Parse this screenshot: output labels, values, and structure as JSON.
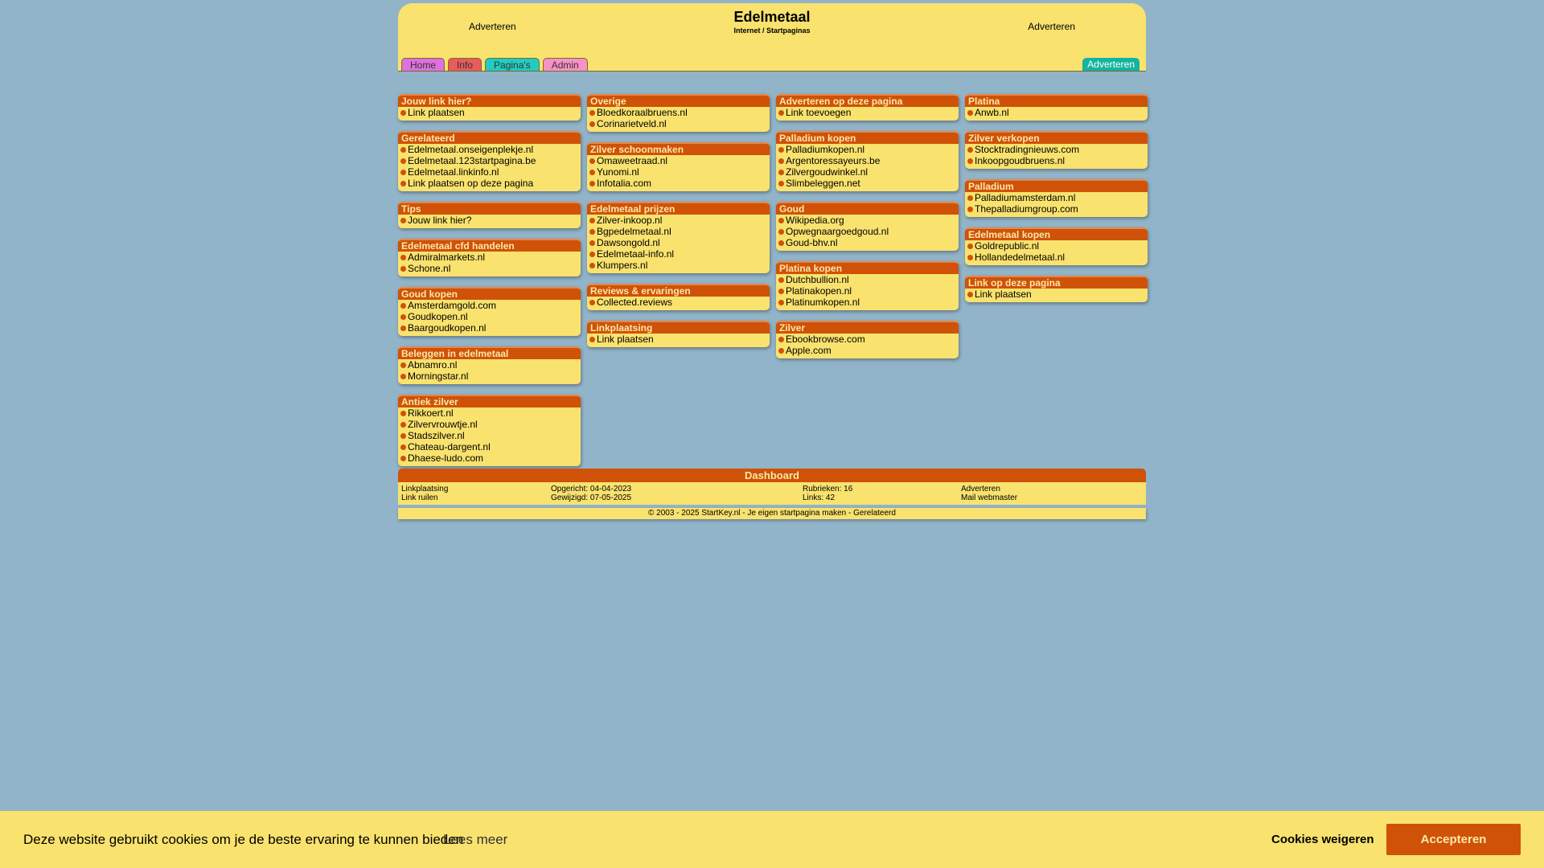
{
  "header": {
    "title": "Edelmetaal",
    "subtitle": "Internet / Startpaginas",
    "ad_left": "Adverteren",
    "ad_right": "Adverteren",
    "tabs": [
      {
        "label": "Home",
        "color": "#df70df"
      },
      {
        "label": "Info",
        "color": "#e85c5c"
      },
      {
        "label": "Pagina's",
        "color": "#22ccc2"
      },
      {
        "label": "Admin",
        "color": "#f792c6"
      }
    ],
    "advertise_tab": "Adverteren"
  },
  "columns": [
    [
      {
        "title": "Jouw link hier?",
        "links": [
          "Link plaatsen"
        ]
      },
      {
        "title": "Gerelateerd",
        "links": [
          "Edelmetaal.onseigenplekje.nl",
          "Edelmetaal.123startpagina.be",
          "Edelmetaal.linkinfo.nl",
          "Link plaatsen op deze pagina"
        ]
      },
      {
        "title": "Tips",
        "links": [
          "Jouw link hier?"
        ]
      },
      {
        "title": "Edelmetaal cfd handelen",
        "links": [
          "Admiralmarkets.nl",
          "Schone.nl"
        ]
      },
      {
        "title": "Goud kopen",
        "links": [
          "Amsterdamgold.com",
          "Goudkopen.nl",
          "Baargoudkopen.nl"
        ]
      },
      {
        "title": "Beleggen in edelmetaal",
        "links": [
          "Abnamro.nl",
          "Morningstar.nl"
        ]
      },
      {
        "title": "Antiek zilver",
        "links": [
          "Rikkoert.nl",
          "Zilvervrouwtje.nl",
          "Stadszilver.nl",
          "Chateau-dargent.nl",
          "Dhaese-ludo.com"
        ]
      }
    ],
    [
      {
        "title": "Overige",
        "links": [
          "Bloedkoraalbruens.nl",
          "Corinarietveld.nl"
        ]
      },
      {
        "title": "Zilver schoonmaken",
        "links": [
          "Omaweetraad.nl",
          "Yunomi.nl",
          "Infotalia.com"
        ]
      },
      {
        "title": "Edelmetaal prijzen",
        "links": [
          "Zilver-inkoop.nl",
          "Bgpedelmetaal.nl",
          "Dawsongold.nl",
          "Edelmetaal-info.nl",
          "Klumpers.nl"
        ]
      },
      {
        "title": "Reviews & ervaringen",
        "links": [
          "Collected.reviews"
        ]
      },
      {
        "title": "Linkplaatsing",
        "links": [
          "Link plaatsen"
        ]
      }
    ],
    [
      {
        "title": "Adverteren op deze pagina",
        "links": [
          "Link toevoegen"
        ]
      },
      {
        "title": "Palladium kopen",
        "links": [
          "Palladiumkopen.nl",
          "Argentoressayeurs.be",
          "Zilvergoudwinkel.nl",
          "Slimbeleggen.net"
        ]
      },
      {
        "title": "Goud",
        "links": [
          "Wikipedia.org",
          "Opwegnaargoedgoud.nl",
          "Goud-bhv.nl"
        ]
      },
      {
        "title": "Platina kopen",
        "links": [
          "Dutchbullion.nl",
          "Platinakopen.nl",
          "Platinumkopen.nl"
        ]
      },
      {
        "title": "Zilver",
        "links": [
          "Ebookbrowse.com",
          "Apple.com"
        ]
      }
    ],
    [
      {
        "title": "Platina",
        "links": [
          "Anwb.nl"
        ]
      },
      {
        "title": "Zilver verkopen",
        "links": [
          "Stocktradingnieuws.com",
          "Inkoopgoudbruens.nl"
        ]
      },
      {
        "title": "Palladium",
        "links": [
          "Palladiumamsterdam.nl",
          "Thepalladiumgroup.com"
        ]
      },
      {
        "title": "Edelmetaal kopen",
        "links": [
          "Goldrepublic.nl",
          "Hollandedelmetaal.nl"
        ]
      },
      {
        "title": "Link op deze pagina",
        "links": [
          "Link plaatsen"
        ]
      }
    ]
  ],
  "dashboard": {
    "title": "Dashboard",
    "linkplaatsing": "Linkplaatsing",
    "link_ruilen": "Link ruilen",
    "opgericht": "Opgericht: 04-04-2023",
    "gewijzigd": "Gewijzigd: 07-05-2025",
    "rubrieken": "Rubrieken: 16",
    "links": "Links: 42",
    "adverteren": "Adverteren",
    "mail": "Mail webmaster"
  },
  "footer": "© 2003 - 2025 StartKey.nl - Je eigen startpagina maken - Gerelateerd",
  "cookie": {
    "message": "Deze website gebruikt cookies om je de beste ervaring te kunnen bieden",
    "more": "Lees meer",
    "refuse": "Cookies weigeren",
    "accept": "Accepteren"
  }
}
